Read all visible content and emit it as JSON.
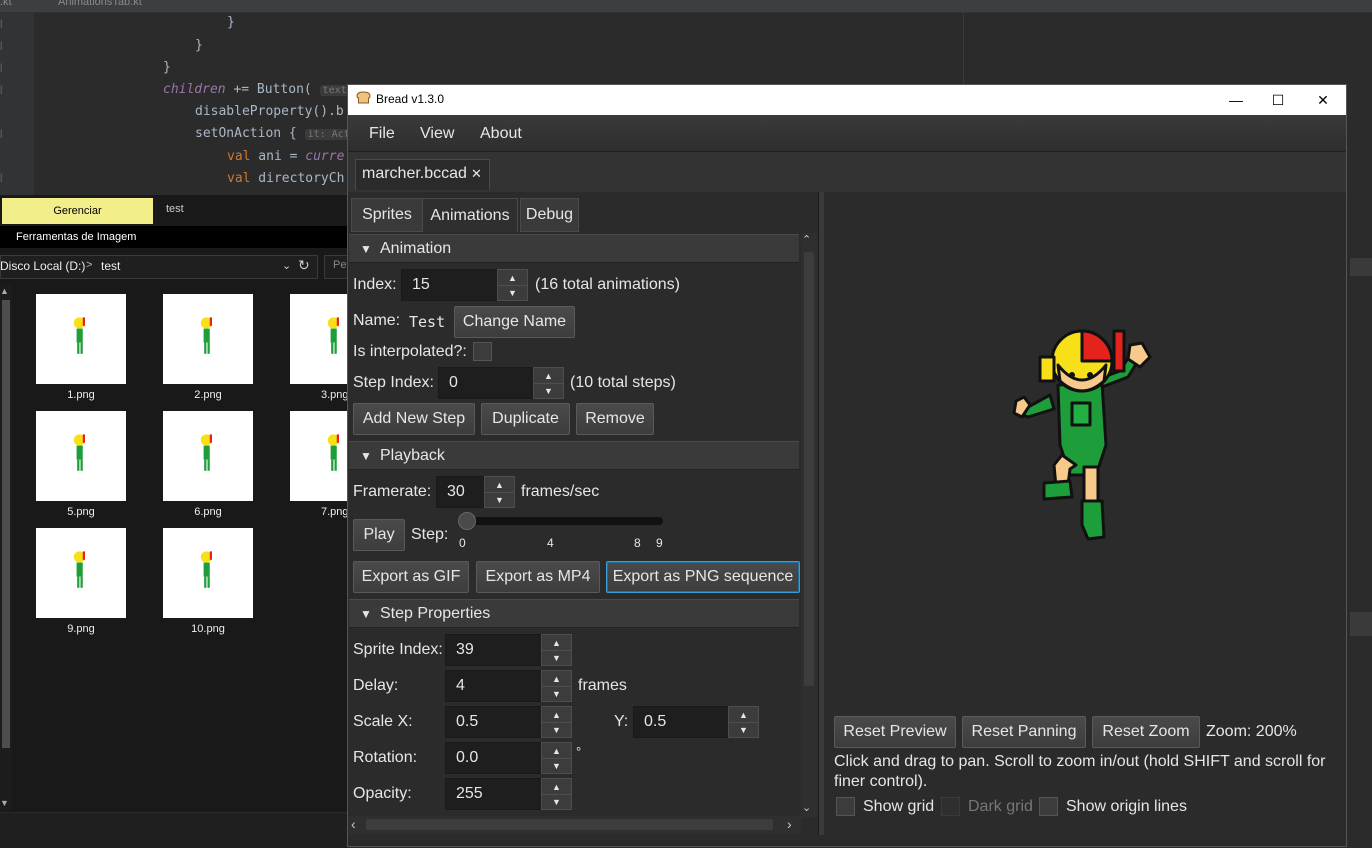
{
  "ide": {
    "tab_label": "AnimationsTab.kt",
    "lines": [
      {
        "text": "}"
      },
      {
        "text": "}"
      },
      {
        "text": "}"
      },
      {
        "kw": "children",
        "rest": " += Button(",
        "hint": "text:"
      },
      {
        "text": "disableProperty().b"
      },
      {
        "text": "setOnAction { ",
        "hint": "it: Act"
      },
      {
        "kw": "val",
        "rest": " ani = ",
        "it": "curre"
      },
      {
        "kw": "val",
        "rest": " directoryCh"
      }
    ]
  },
  "explorer": {
    "ribbon_tab_manage": "Gerenciar",
    "ribbon_tab_folder": "test",
    "ribbon_group": "Ferramentas de Imagem",
    "address_drive": "Disco Local (D:)",
    "address_sep": ">",
    "address_folder": "test",
    "search_placeholder": "Pe",
    "files": [
      "1.png",
      "2.png",
      "3.png",
      "5.png",
      "6.png",
      "7.png",
      "9.png",
      "10.png"
    ]
  },
  "window": {
    "title": "Bread v1.3.0",
    "controls": {
      "minimize": "—",
      "maximize": "☐",
      "close": "✕"
    },
    "menu": [
      "File",
      "View",
      "About"
    ],
    "file_tab": "marcher.bccad",
    "file_tab_close": "✕"
  },
  "tabs": [
    "Sprites",
    "Animations",
    "Debug"
  ],
  "active_tab": "Animations",
  "animation": {
    "header": "Animation",
    "index_label": "Index:",
    "index_value": "15",
    "total": "(16 total animations)",
    "name_label": "Name:",
    "name_value": "Test",
    "change_name": "Change Name",
    "interpolated_label": "Is interpolated?:",
    "interpolated": false,
    "step_index_label": "Step Index:",
    "step_index_value": "0",
    "total_steps": "(10 total steps)",
    "add_step": "Add New Step",
    "duplicate": "Duplicate",
    "remove": "Remove"
  },
  "playback": {
    "header": "Playback",
    "framerate_label": "Framerate:",
    "framerate_value": "30",
    "framerate_unit": "frames/sec",
    "play": "Play",
    "step_label": "Step:",
    "step_value": 0,
    "step_max": 9,
    "step_ticks": [
      "0",
      "4",
      "8",
      "9"
    ],
    "export_gif": "Export as GIF",
    "export_mp4": "Export as MP4",
    "export_png": "Export as PNG sequence"
  },
  "step_properties": {
    "header": "Step Properties",
    "sprite_index_label": "Sprite Index:",
    "sprite_index_value": "39",
    "delay_label": "Delay:",
    "delay_value": "4",
    "delay_unit": "frames",
    "scale_x_label": "Scale X:",
    "scale_x_value": "0.5",
    "scale_y_label": "Y:",
    "scale_y_value": "0.5",
    "rotation_label": "Rotation:",
    "rotation_value": "0.0",
    "rotation_unit": "°",
    "opacity_label": "Opacity:",
    "opacity_value": "255"
  },
  "preview": {
    "reset_preview": "Reset Preview",
    "reset_panning": "Reset Panning",
    "reset_zoom": "Reset Zoom",
    "zoom": "Zoom: 200%",
    "help": "Click and drag to pan. Scroll to zoom in/out (hold SHIFT and scroll for finer control).",
    "show_grid": "Show grid",
    "show_grid_checked": false,
    "dark_grid": "Dark grid",
    "dark_grid_enabled": false,
    "show_origin": "Show origin lines",
    "show_origin_checked": false
  },
  "colors": {
    "accent_focus": "#3a9fd6",
    "ribbon_active": "#f2ee8a",
    "sprite_green": "#1e9e3a",
    "sprite_yellow": "#f7e017",
    "sprite_red": "#e3231c"
  }
}
